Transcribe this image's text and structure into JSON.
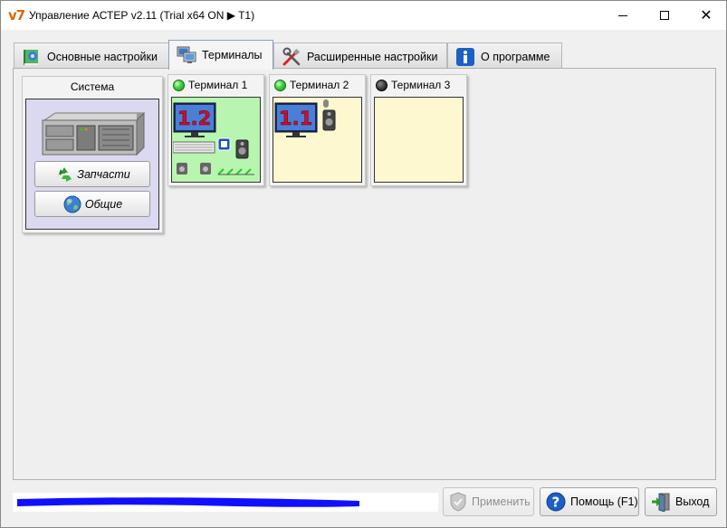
{
  "window": {
    "title": "Управление АСТЕР v2.11 (Trial x64 ON ▶ T1)",
    "logo": "v7"
  },
  "tabs": [
    {
      "label": "Основные настройки",
      "icon": "settings-book-icon"
    },
    {
      "label": "Терминалы",
      "icon": "computer-network-icon",
      "active": true
    },
    {
      "label": "Расширенные настройки",
      "icon": "tools-icon"
    },
    {
      "label": "О программе",
      "icon": "info-icon"
    }
  ],
  "system_card": {
    "title": "Система",
    "buttons": [
      {
        "label": "Запчасти",
        "icon": "recycle-icon"
      },
      {
        "label": "Общие",
        "icon": "globe-icon"
      }
    ]
  },
  "terminals": [
    {
      "label": "Терминал 1",
      "status": "on",
      "monitor_label": "1.2",
      "body_color": "#b8f5b0"
    },
    {
      "label": "Терминал 2",
      "status": "on",
      "monitor_label": "1.1",
      "body_color": "#fdf8cf"
    },
    {
      "label": "Терминал 3",
      "status": "off",
      "monitor_label": "",
      "body_color": "#fdf8cf"
    }
  ],
  "footer": {
    "apply_label": "Применить",
    "help_label": "Помощь (F1)",
    "exit_label": "Выход",
    "status_text": ""
  },
  "colors": {
    "system_body": "#dad9f0",
    "led_on": "#3fd83f",
    "led_off": "#333333",
    "monitor_digit": "#c8102e",
    "redaction": "#1010ff"
  }
}
